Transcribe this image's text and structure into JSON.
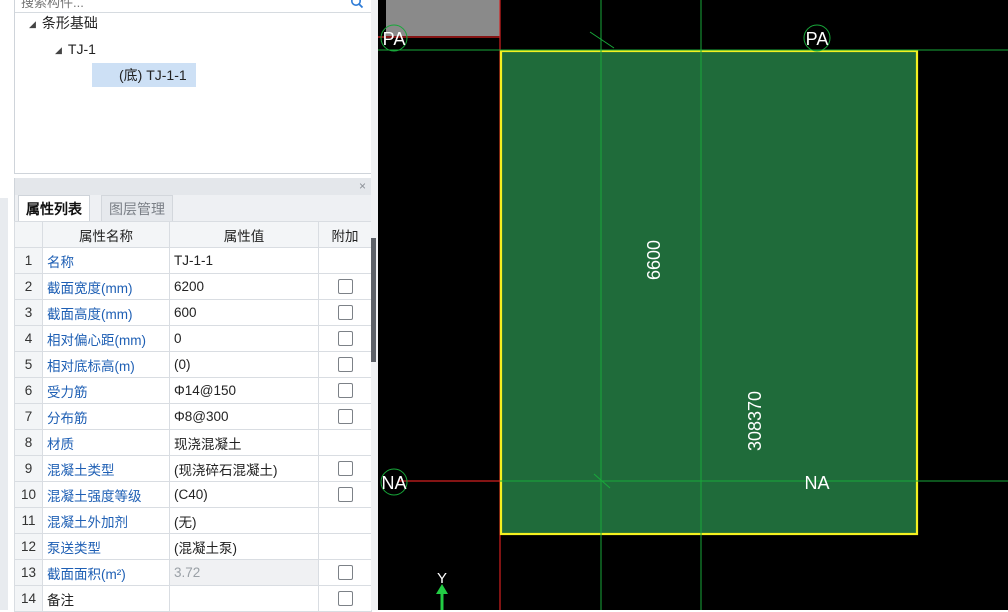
{
  "tree": {
    "search_placeholder": "搜索构件...",
    "level1": "条形基础",
    "level2": "TJ-1",
    "level3": "(底) TJ-1-1"
  },
  "props": {
    "tab_active": "属性列表",
    "tab_inactive": "图层管理",
    "close": "×",
    "headers": {
      "name": "属性名称",
      "value": "属性值",
      "extra": "附加"
    },
    "rows": [
      {
        "num": "1",
        "name": "名称",
        "value": "TJ-1-1"
      },
      {
        "num": "2",
        "name": "截面宽度(mm)",
        "value": "6200"
      },
      {
        "num": "3",
        "name": "截面高度(mm)",
        "value": "600"
      },
      {
        "num": "4",
        "name": "相对偏心距(mm)",
        "value": "0"
      },
      {
        "num": "5",
        "name": "相对底标高(m)",
        "value": "(0)"
      },
      {
        "num": "6",
        "name": "受力筋",
        "value": "Φ14@150"
      },
      {
        "num": "7",
        "name": "分布筋",
        "value": "Φ8@300"
      },
      {
        "num": "8",
        "name": "材质",
        "value": "现浇混凝土"
      },
      {
        "num": "9",
        "name": "混凝土类型",
        "value": "(现浇碎石混凝土)"
      },
      {
        "num": "10",
        "name": "混凝土强度等级",
        "value": "(C40)"
      },
      {
        "num": "11",
        "name": "混凝土外加剂",
        "value": "(无)"
      },
      {
        "num": "12",
        "name": "泵送类型",
        "value": "(混凝土泵)"
      },
      {
        "num": "13",
        "name": "截面面积(m²)",
        "value": "3.72"
      },
      {
        "num": "14",
        "name": "备注",
        "value": ""
      }
    ]
  },
  "canvas": {
    "axis_label_pa": "PA",
    "axis_label_na": "NA",
    "dim_vertical": "6600",
    "dim_length": "308370",
    "ucs_y": "Y",
    "colors": {
      "slab_fill": "#1f6b3a",
      "slab_border": "#f4f020",
      "grid": "#18a83a",
      "axis_red": "#d42020",
      "background": "#000000"
    }
  }
}
